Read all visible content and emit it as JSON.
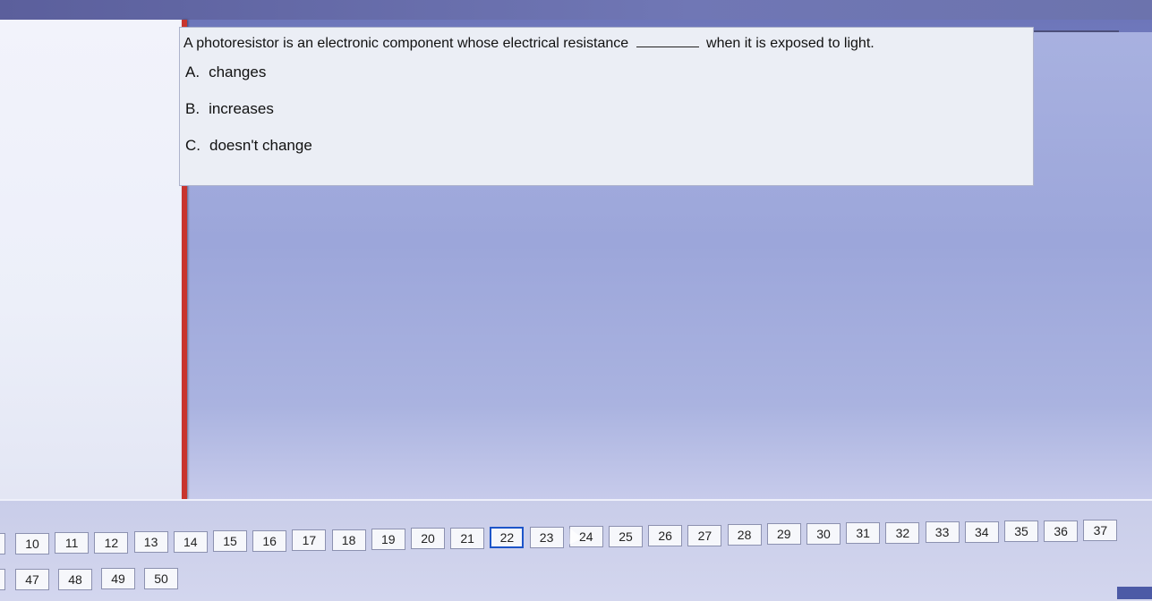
{
  "question": {
    "text_before": "A photoresistor is an electronic component whose electrical resistance",
    "text_after": "when it is exposed to light."
  },
  "options": [
    {
      "letter": "A.",
      "label": "changes"
    },
    {
      "letter": "B.",
      "label": "increases"
    },
    {
      "letter": "C.",
      "label": "doesn't change"
    }
  ],
  "navigation": {
    "current": "22",
    "row1": [
      "10",
      "11",
      "12",
      "13",
      "14",
      "15",
      "16",
      "17",
      "18",
      "19",
      "20",
      "21",
      "22",
      "23",
      "24",
      "25",
      "26",
      "27",
      "28",
      "29",
      "30",
      "31",
      "32",
      "33",
      "34",
      "35",
      "36",
      "37"
    ],
    "row2": [
      "47",
      "48",
      "49",
      "50"
    ]
  }
}
